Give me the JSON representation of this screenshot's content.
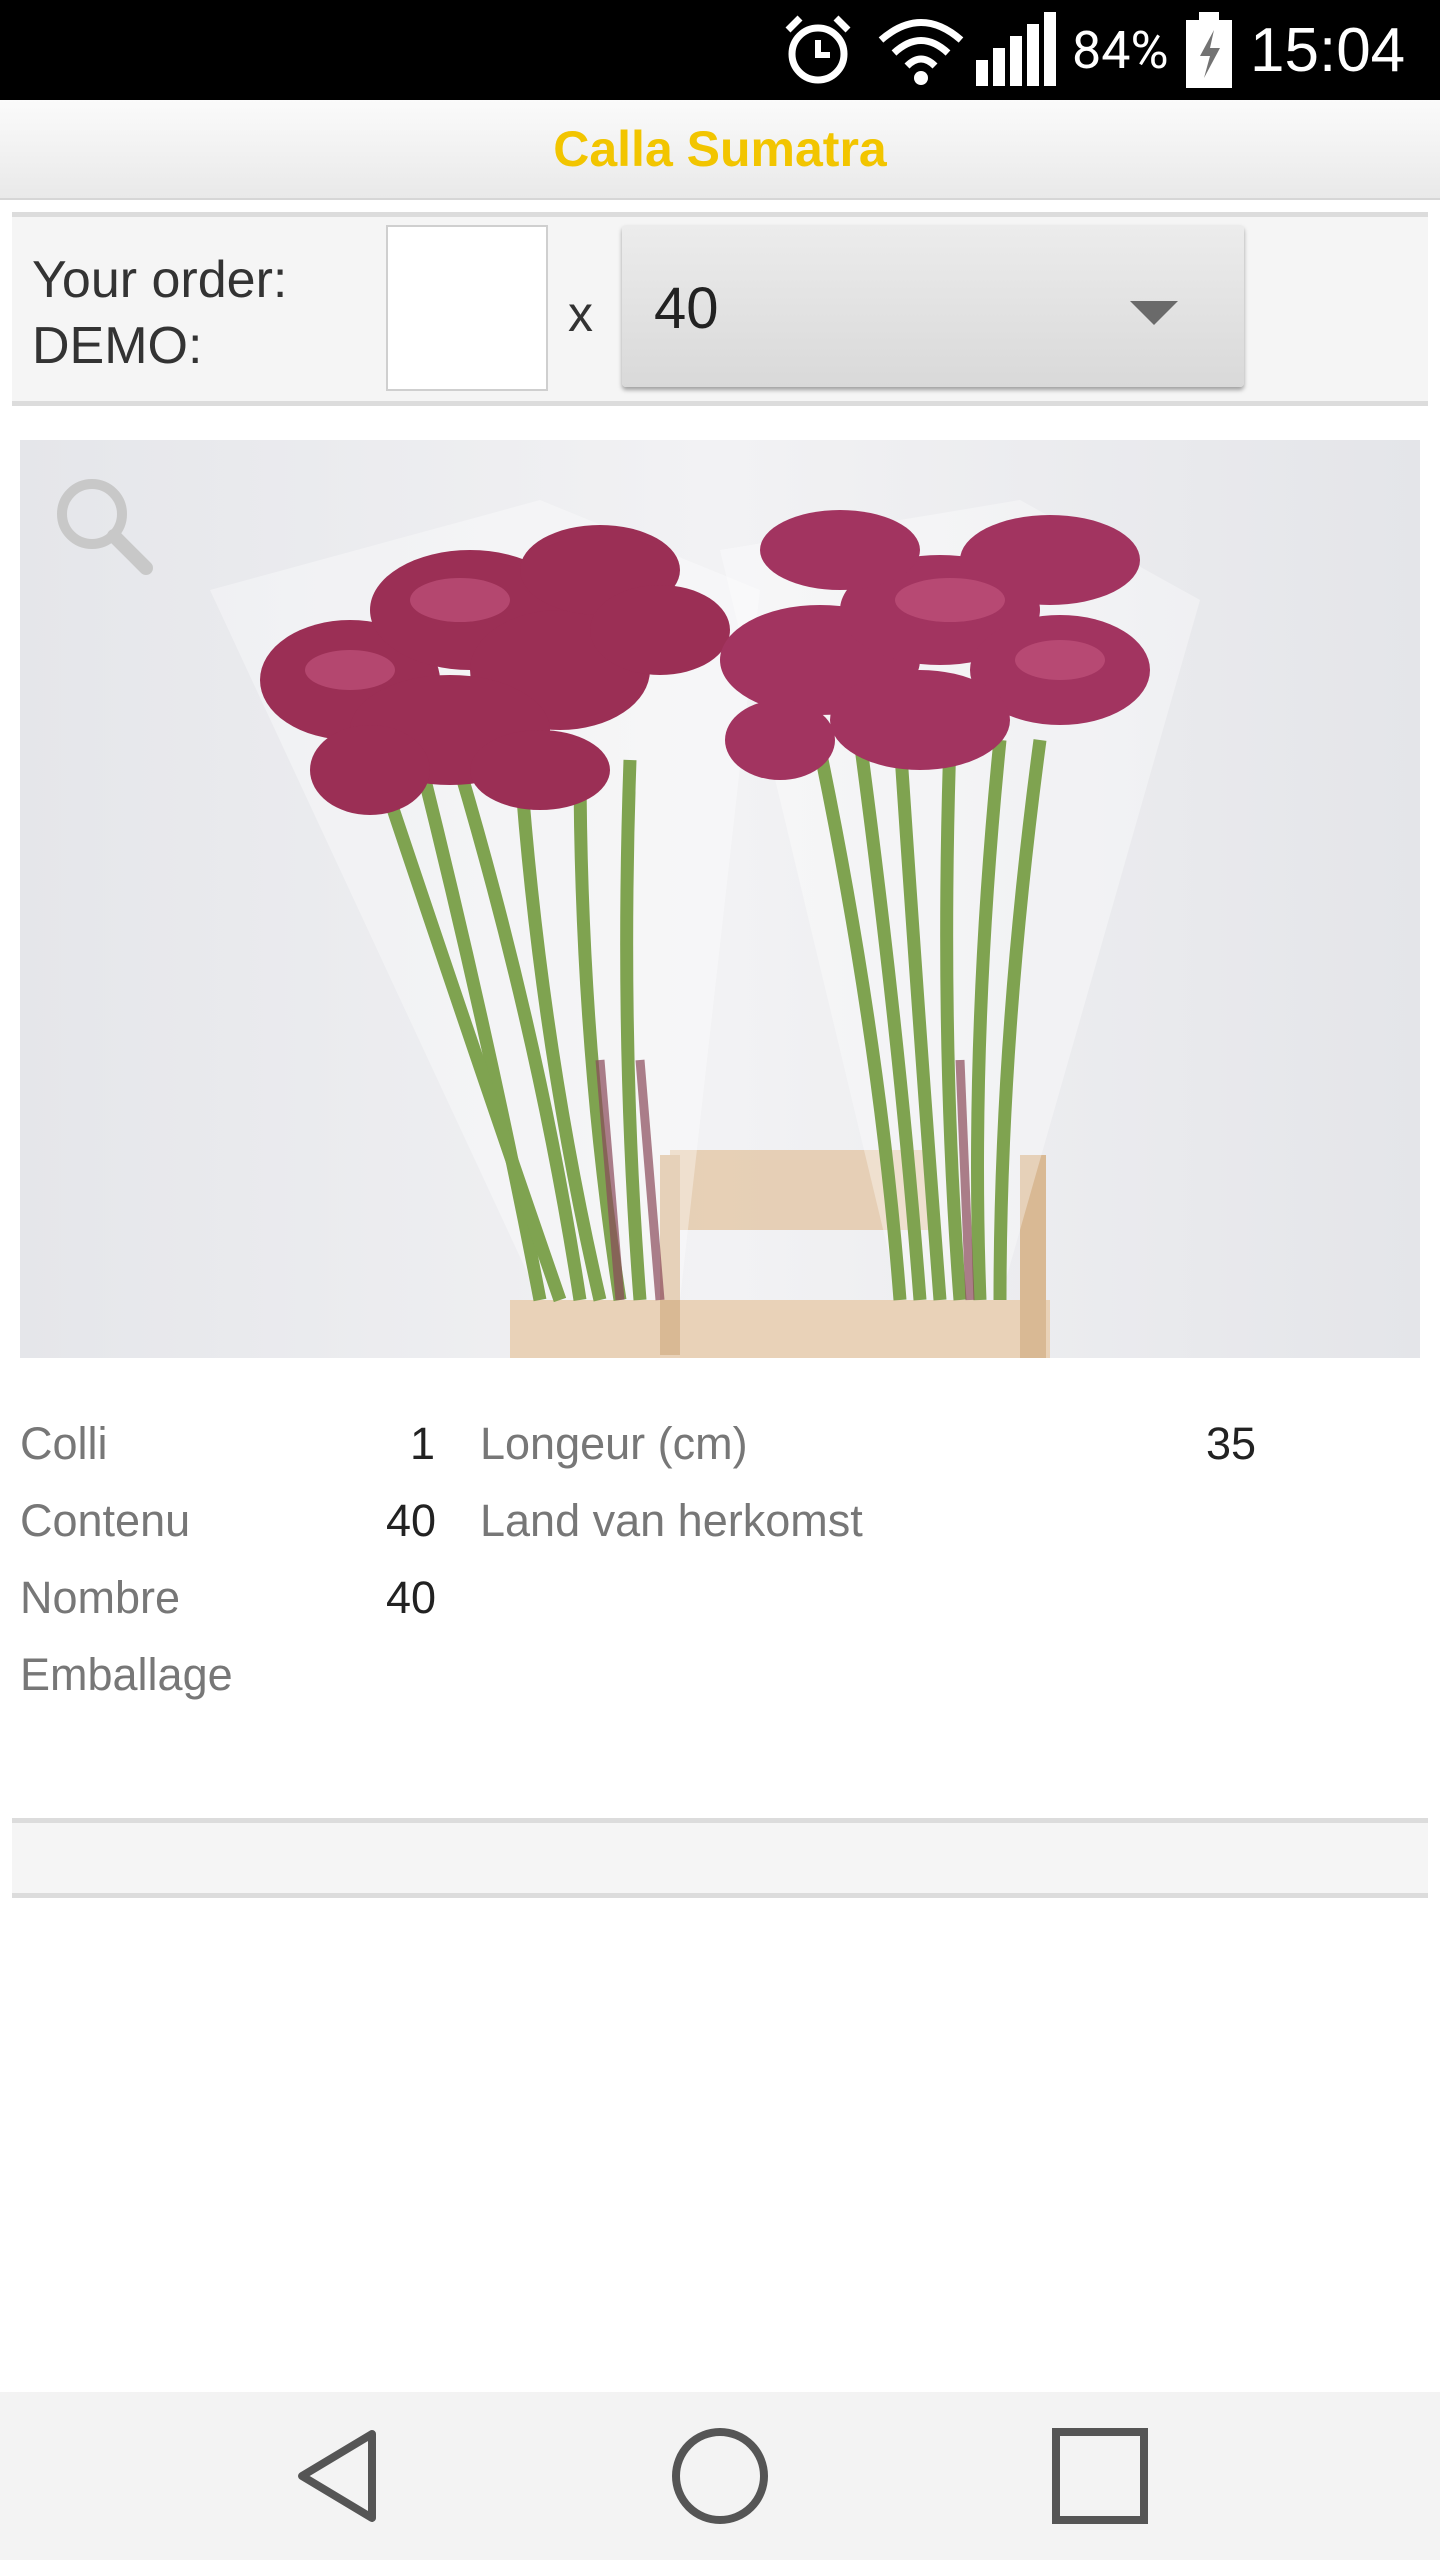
{
  "status_bar": {
    "battery_percent": "84%",
    "time": "15:04",
    "icons": [
      "alarm-icon",
      "wifi-icon",
      "signal-icon",
      "battery-charging-icon"
    ]
  },
  "header": {
    "title": "Calla Sumatra",
    "title_color": "#f2c500"
  },
  "order": {
    "label_line1": "Your order:",
    "label_line2": "DEMO:",
    "quantity_value": "",
    "times_symbol": "x",
    "pack_select_value": "40"
  },
  "product_image": {
    "overlay_icon": "zoom-icon"
  },
  "specs": {
    "left": [
      {
        "label": "Colli",
        "value": "1"
      },
      {
        "label": "Contenu",
        "value": "40"
      },
      {
        "label": "Nombre",
        "value": "40"
      },
      {
        "label": "Emballage",
        "value": ""
      }
    ],
    "right": [
      {
        "label": "Longeur (cm)",
        "value": "35"
      },
      {
        "label": "Land van herkomst",
        "value": ""
      }
    ]
  },
  "nav": {
    "icons": [
      "back-icon",
      "home-icon",
      "recents-icon"
    ]
  }
}
